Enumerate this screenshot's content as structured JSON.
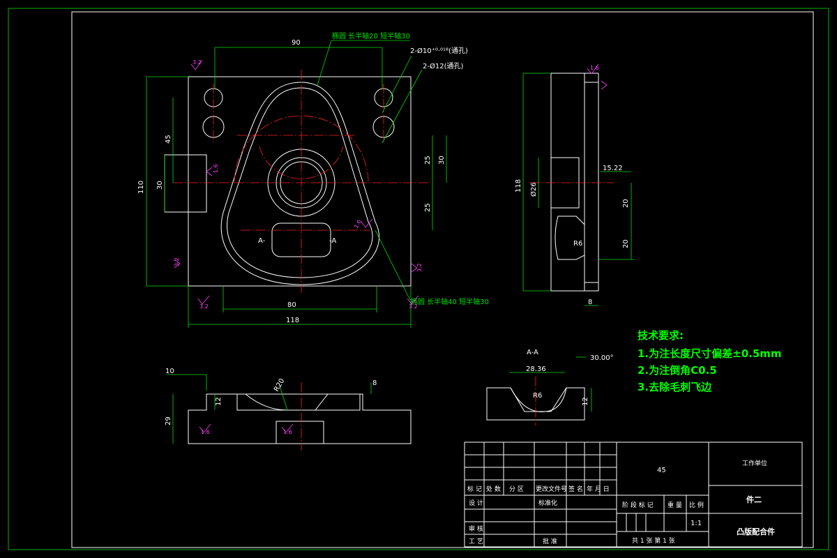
{
  "drawing": {
    "annotations": {
      "ellipse_top": "椭圆 长半轴20 短半轴30",
      "ellipse_bottom": "椭圆 长半轴40 短半轴30",
      "hole_10": "2-Ø10⁺⁰·⁰¹⁸(通孔)",
      "hole_12": "2-Ø12(通孔)"
    },
    "dims": {
      "top_90": "90",
      "d_45": "45",
      "d_25a": "25",
      "d_25b": "25",
      "d_30r": "30",
      "d_110": "110",
      "d_30l": "30",
      "d_80": "80",
      "d_118": "118",
      "side_118": "118",
      "side_26": "Ø26",
      "side_1522": "15.22",
      "side_20": "20",
      "side_20b": "20",
      "side_R6": "R6",
      "side_8": "8",
      "bot_10": "10",
      "bot_12": "12",
      "bot_29": "29",
      "bot_R20": "R20",
      "bot_8": "8",
      "aa_title": "A-A",
      "aa_2836": "28.36",
      "aa_30deg": "30.00°",
      "aa_R6": "R6",
      "aa_12": "12",
      "sec_a_left": "A-",
      "sec_a_right": "-A"
    },
    "roughness": {
      "r32": "3.2",
      "r16": "1.6"
    }
  },
  "tech_requirements": {
    "title": "技术要求:",
    "items": [
      "1.为注长度尺寸偏差±0.5mm",
      "2.为注倒角C0.5",
      "3.去除毛刺飞边"
    ]
  },
  "title_block": {
    "material": "45",
    "company": "工作单位",
    "part_no": "件二",
    "part_name": "凸版配合件",
    "scale": "1:1",
    "sheets": "共 1 张   第 1 张",
    "headers": [
      "标 记",
      "处 数",
      "分  区",
      "更改文件号",
      "签 名",
      "年 月 日"
    ],
    "design": "设 计",
    "standardize": "标准化",
    "review": "审 核",
    "process": "工 艺",
    "approve": "批 准",
    "stage_mark": "阶 段 标 记",
    "weight": "重 量",
    "scale_label": "比 例"
  }
}
